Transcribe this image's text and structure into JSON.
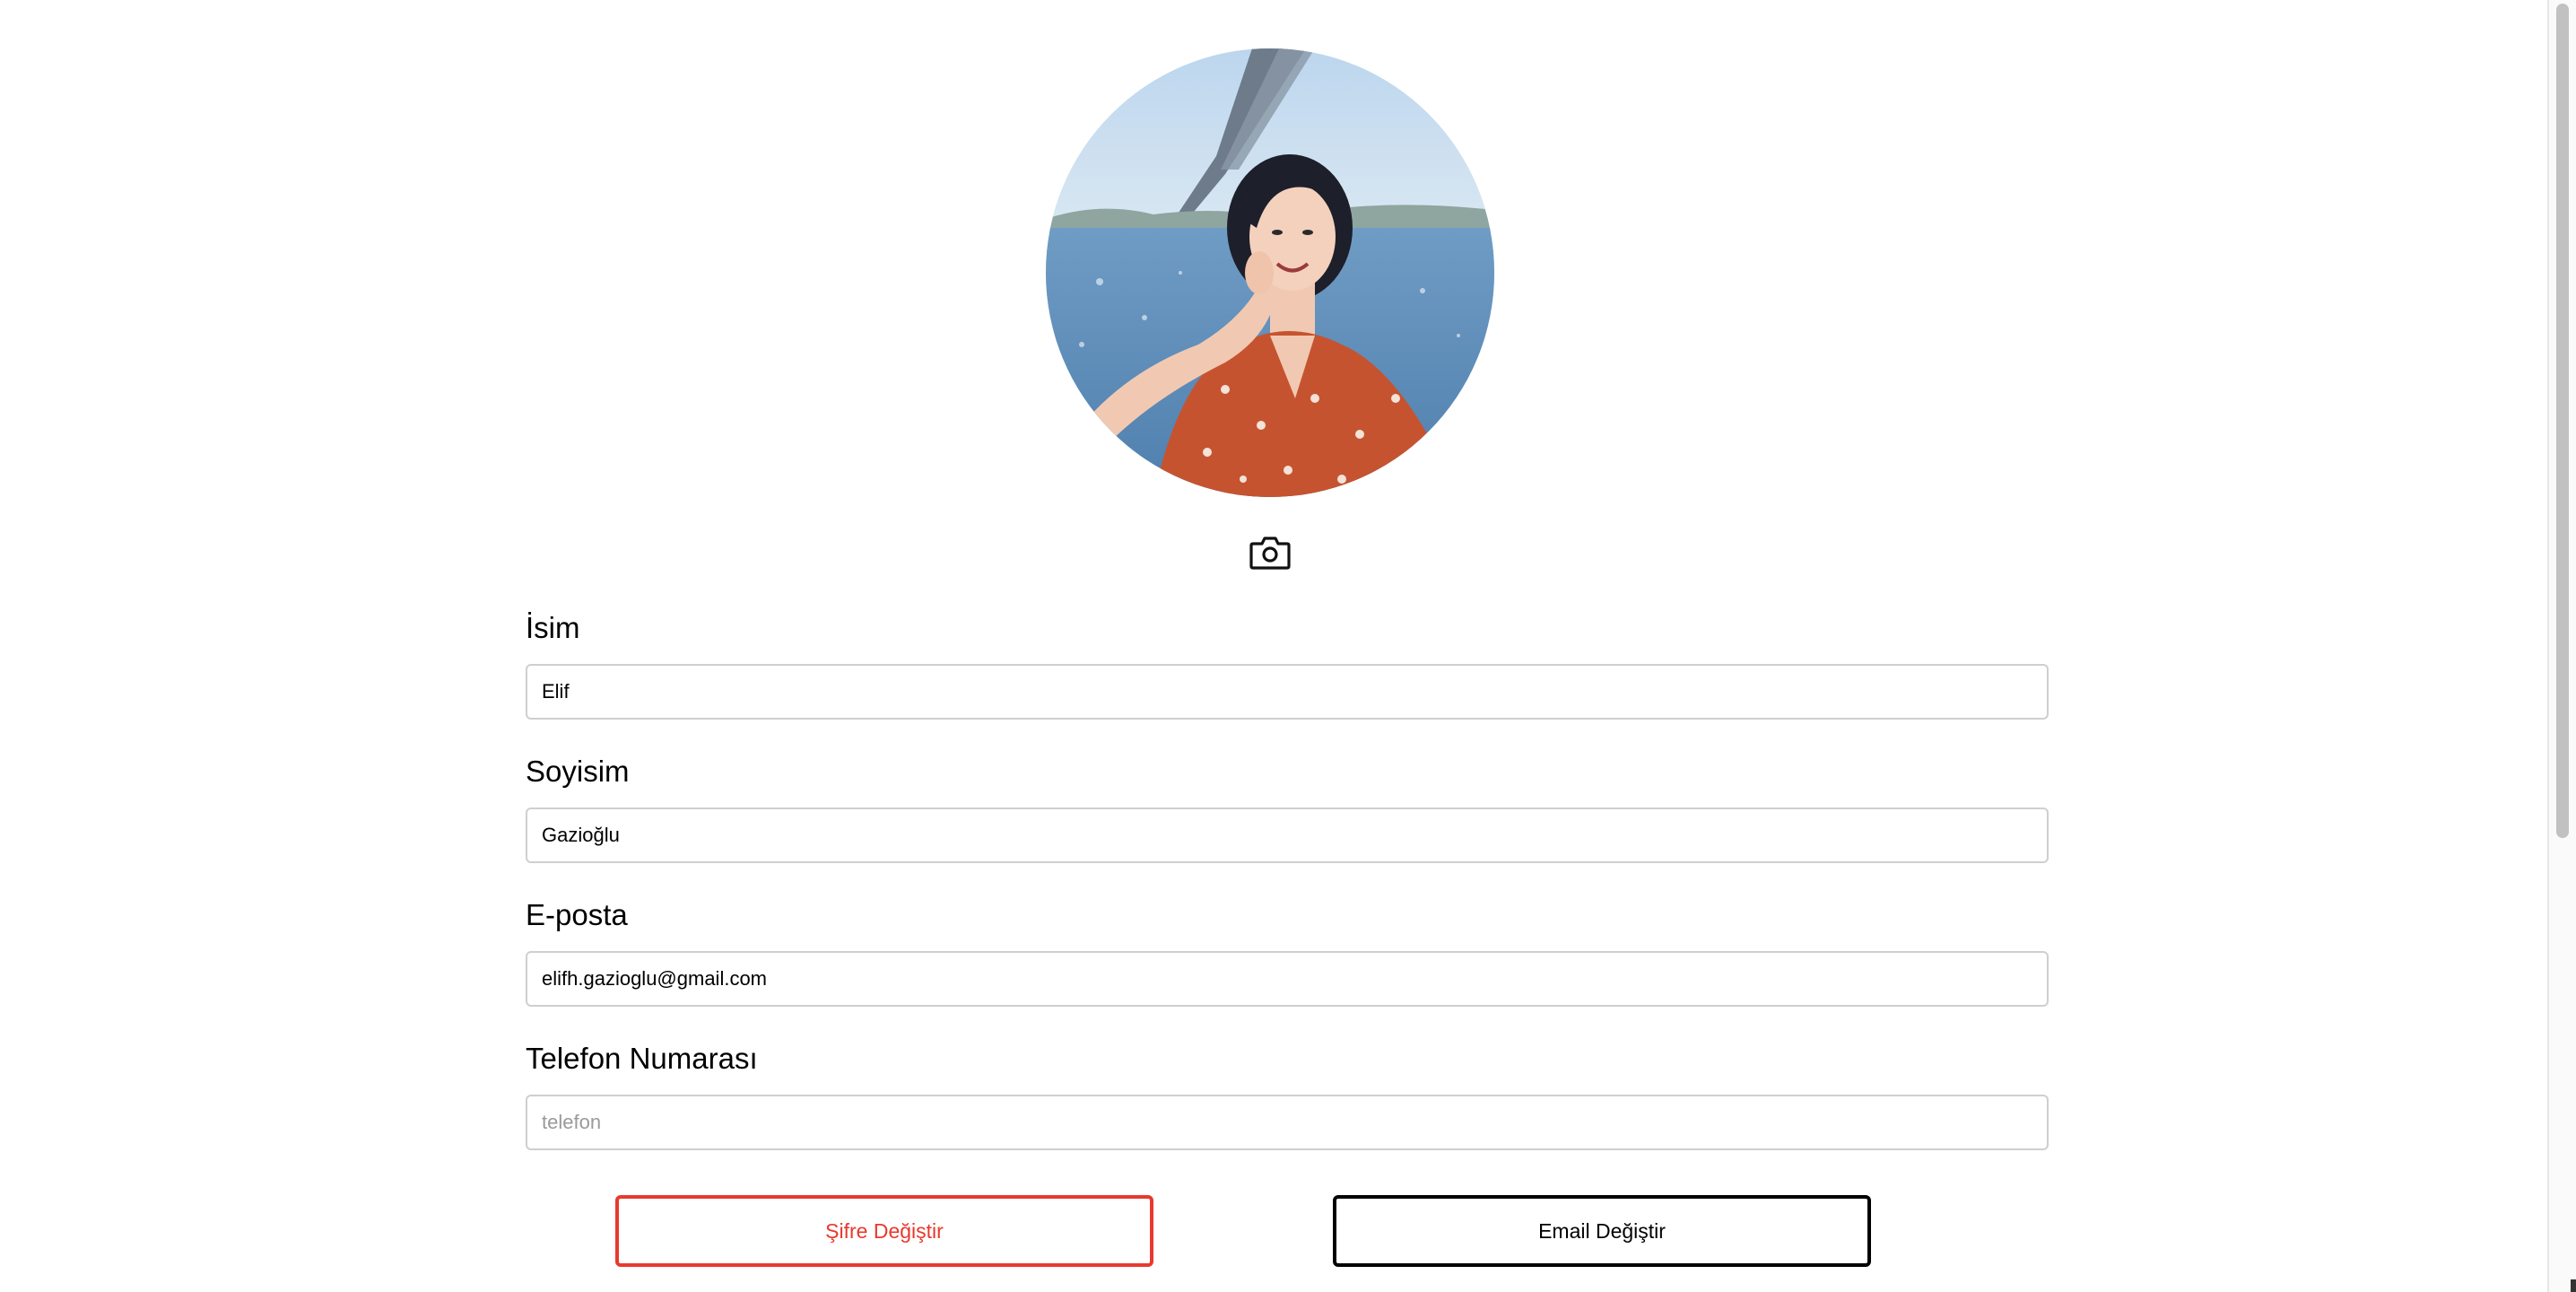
{
  "profile": {
    "avatar_icon": "profile-photo",
    "camera_icon": "camera-icon"
  },
  "form": {
    "first_name": {
      "label": "İsim",
      "value": "Elif",
      "placeholder": ""
    },
    "last_name": {
      "label": "Soyisim",
      "value": "Gazioğlu",
      "placeholder": ""
    },
    "email": {
      "label": "E-posta",
      "value": "elifh.gazioglu@gmail.com",
      "placeholder": ""
    },
    "phone": {
      "label": "Telefon Numarası",
      "value": "",
      "placeholder": "telefon"
    }
  },
  "actions": {
    "change_password_label": "Şifre Değiştir",
    "change_email_label": "Email Değiştir"
  },
  "colors": {
    "danger": "#e8392e",
    "border": "#cfcfcf",
    "text": "#000000"
  }
}
